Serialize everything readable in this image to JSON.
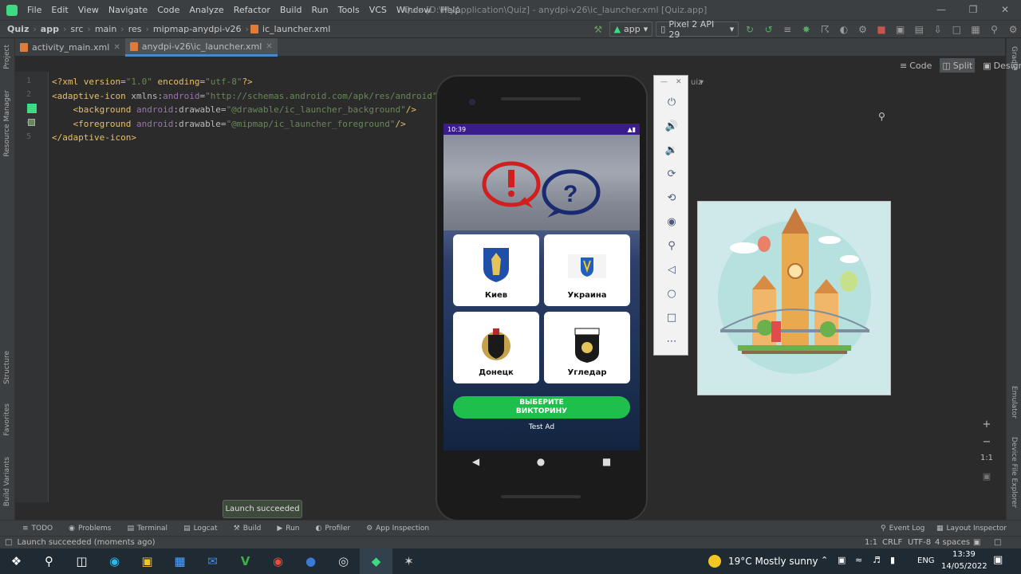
{
  "menu": [
    "File",
    "Edit",
    "View",
    "Navigate",
    "Code",
    "Analyze",
    "Refactor",
    "Build",
    "Run",
    "Tools",
    "VCS",
    "Window",
    "Help"
  ],
  "window_title": "Quiz [D:\\MyApplication\\Quiz] - anydpi-v26\\ic_launcher.xml [Quiz.app]",
  "breadcrumbs": [
    "Quiz",
    "app",
    "src",
    "main",
    "res",
    "mipmap-anydpi-v26",
    "ic_launcher.xml"
  ],
  "toolbar": {
    "run_config": "app",
    "device": "Pixel 2 API 29"
  },
  "tabs": [
    {
      "label": "activity_main.xml"
    },
    {
      "label": "anydpi-v26\\ic_launcher.xml"
    }
  ],
  "left_tools": [
    "Project",
    "Resource Manager",
    "Structure",
    "Favorites",
    "Build Variants"
  ],
  "right_tools": [
    "Gradle",
    "Emulator",
    "Device File Explorer"
  ],
  "editor": {
    "line_numbers": [
      "1",
      "2",
      "3",
      "4",
      "5"
    ],
    "lines": [
      [
        {
          "c": "pi",
          "t": "<?xml version="
        },
        {
          "c": "av",
          "t": "\"1.0\""
        },
        {
          "c": "pi",
          "t": " encoding="
        },
        {
          "c": "av",
          "t": "\"utf-8\""
        },
        {
          "c": "pi",
          "t": "?>"
        }
      ],
      [
        {
          "c": "tg",
          "t": "<adaptive-icon "
        },
        {
          "c": "an",
          "t": "xmlns:"
        },
        {
          "c": "ns",
          "t": "android"
        },
        {
          "c": "an",
          "t": "="
        },
        {
          "c": "av",
          "t": "\"http://schemas.android.com/apk/res/android\""
        }
      ],
      [
        {
          "c": "tg",
          "t": "    <background "
        },
        {
          "c": "ns",
          "t": "android"
        },
        {
          "c": "an",
          "t": ":drawable="
        },
        {
          "c": "av",
          "t": "\"@drawable/ic_launcher_background\""
        },
        {
          "c": "tg",
          "t": "/>"
        }
      ],
      [
        {
          "c": "tg",
          "t": "    <foreground "
        },
        {
          "c": "ns",
          "t": "android"
        },
        {
          "c": "an",
          "t": ":drawable="
        },
        {
          "c": "av",
          "t": "\"@mipmap/ic_launcher_foreground\""
        },
        {
          "c": "tg",
          "t": "/>"
        }
      ],
      [
        {
          "c": "tg",
          "t": "</adaptive-icon>"
        }
      ]
    ]
  },
  "view_modes": {
    "code": "Code",
    "split": "Split",
    "design": "Design"
  },
  "design_fragment": "uiz",
  "phone": {
    "time": "10:39",
    "cards": [
      {
        "label": "Киев"
      },
      {
        "label": "Украина"
      },
      {
        "label": "Донецк"
      },
      {
        "label": "Угледар"
      }
    ],
    "emblem_text": "УГЛЕДАР",
    "quiz_button": [
      "ВЫБЕРИТЕ",
      "ВИКТОРИНУ"
    ],
    "test_ad": "Test Ad"
  },
  "zoom": {
    "plus": "+",
    "minus": "−",
    "ratio": "1:1"
  },
  "bottom_tools": [
    "TODO",
    "Problems",
    "Terminal",
    "Logcat",
    "Build",
    "Run",
    "Profiler",
    "App Inspection"
  ],
  "bottom_right_tools": [
    "Event Log",
    "Layout Inspector"
  ],
  "toast": "Launch succeeded",
  "status": {
    "message": "Launch succeeded (moments ago)",
    "position": "1:1",
    "line_sep": "CRLF",
    "encoding": "UTF-8",
    "indent": "4 spaces"
  },
  "taskbar": {
    "weather": "19°C  Mostly sunny",
    "lang": "ENG",
    "time": "13:39",
    "date": "14/05/2022"
  },
  "colors": {
    "ide_bg": "#2b2b2b",
    "panel": "#3c3f41",
    "accent": "#4a88c7",
    "quiz_button": "#1fbf4e",
    "status_bar": "#3a1d8a"
  }
}
